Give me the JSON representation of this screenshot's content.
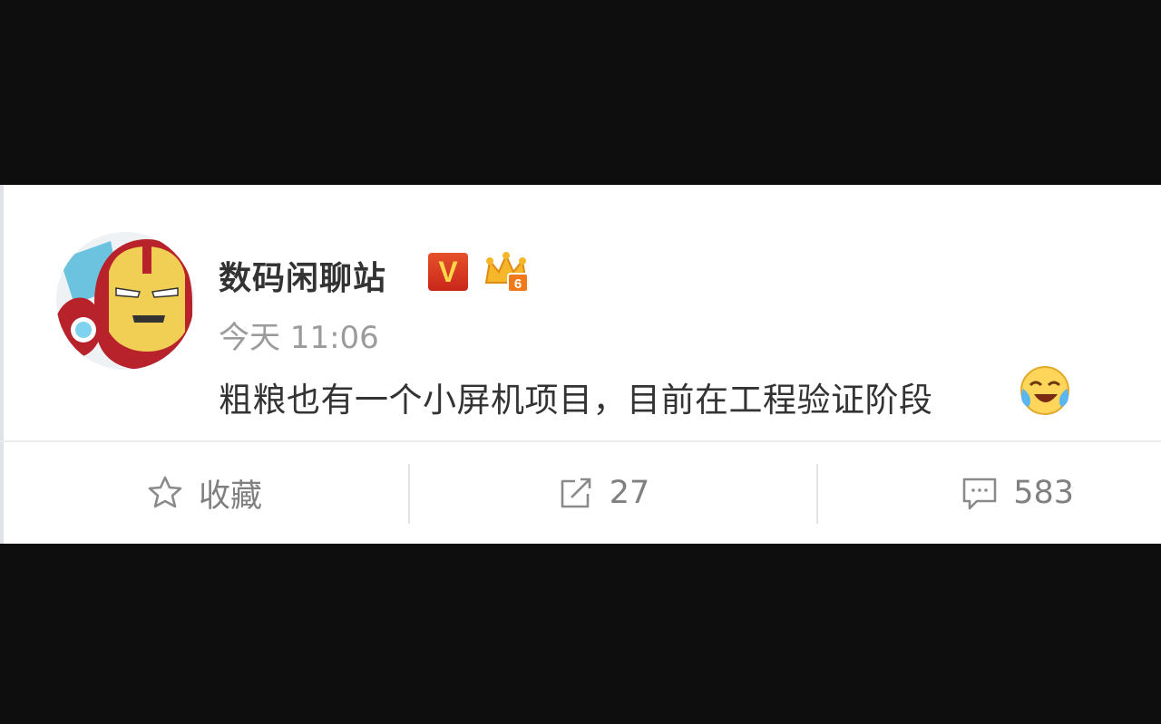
{
  "post": {
    "username": "数码闲聊站",
    "verified_badge": "V",
    "vip_level": "6",
    "time": "今天 11:06",
    "content": "粗粮也有一个小屏机项目，目前在工程验证阶段",
    "content_emoji": "cry-laugh-emoji"
  },
  "actions": {
    "favorite_label": "收藏",
    "repost_count": "27",
    "comment_count": "583"
  },
  "icons": {
    "favorite": "star-outline-icon",
    "repost": "share-arrow-icon",
    "comment": "speech-bubble-icon"
  },
  "colors": {
    "background_letterbox": "#0e0e0f",
    "card": "#ffffff",
    "username": "#333333",
    "timestamp": "#9b9b9b",
    "action_text": "#808080",
    "verified_badge": "#d83a22"
  }
}
